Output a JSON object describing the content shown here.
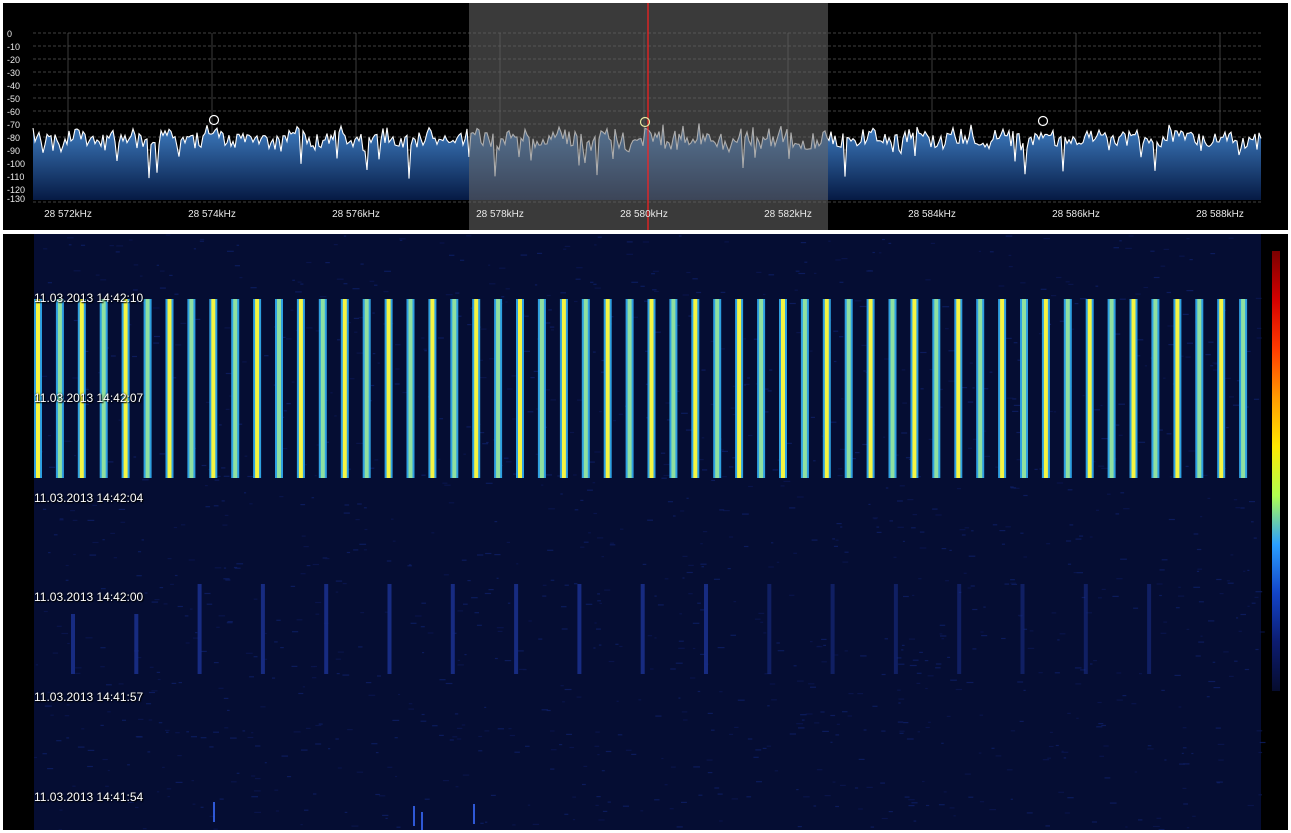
{
  "spectrum": {
    "db_scale": [
      "0",
      "-10",
      "-20",
      "-30",
      "-40",
      "-50",
      "-60",
      "-70",
      "-80",
      "-90",
      "-100",
      "-110",
      "-120",
      "-130"
    ],
    "freq_labels": [
      "28 572kHz",
      "28 574kHz",
      "28 576kHz",
      "28 578kHz",
      "28 580kHz",
      "28 582kHz",
      "28 584kHz",
      "28 586kHz",
      "28 588kHz"
    ],
    "tuned_frequency_label": "28 580kHz",
    "colors": {
      "background": "#000000",
      "fill_top": "#3f7fc4",
      "fill_bottom": "#061a44",
      "trace": "#ffffff",
      "grid": "#555555",
      "filter_band": "#6a6a6a",
      "tuning_line": "#ff2020",
      "peak_marker": "#e8e8a0"
    }
  },
  "waterfall": {
    "timestamps": [
      "11.03.2013 14:42:10",
      "11.03.2013 14:42:07",
      "11.03.2013 14:42:04",
      "11.03.2013 14:42:00",
      "11.03.2013 14:41:57",
      "11.03.2013 14:41:54"
    ],
    "colors": {
      "background": "#050d33",
      "strong_signal": "#f5f542",
      "medium_signal": "#2e9fe0",
      "weak_signal": "#1a2f8a"
    },
    "color_scale": [
      "#7a0000",
      "#d40000",
      "#ff3a00",
      "#ff9a00",
      "#ffe800",
      "#b0ff50",
      "#2a9fff",
      "#1244c8",
      "#0c1c70",
      "#060c2e"
    ]
  }
}
